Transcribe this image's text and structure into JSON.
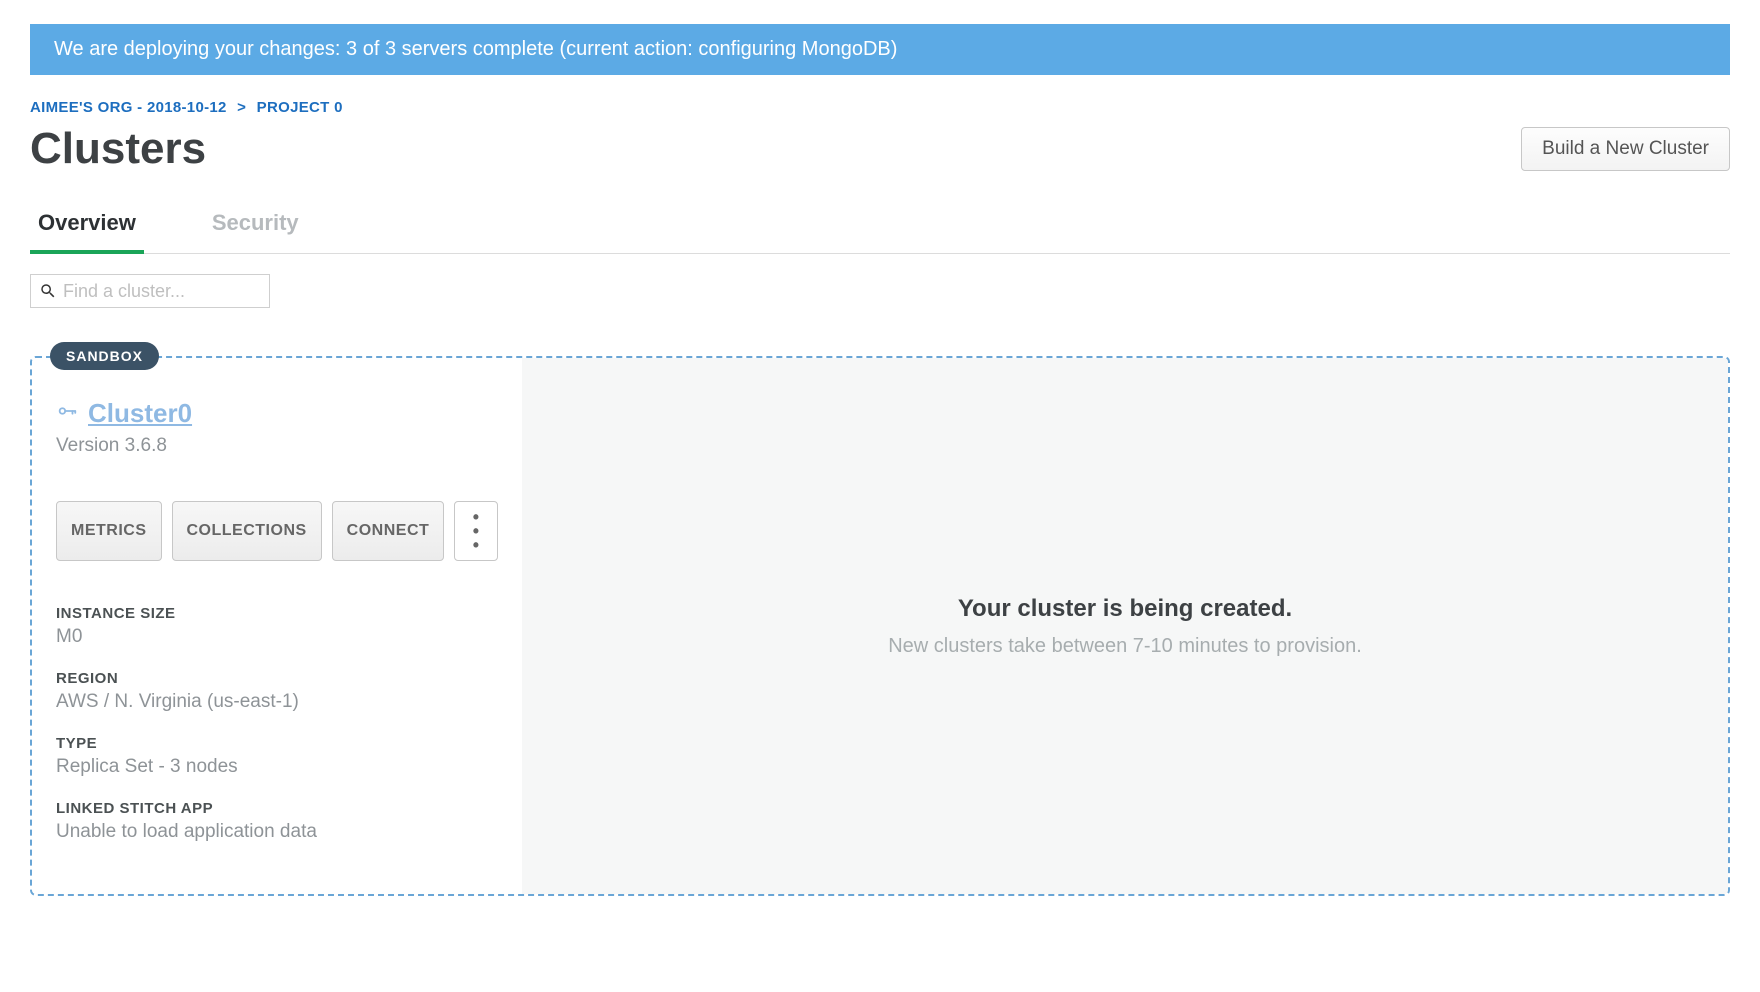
{
  "banner": {
    "text": "We are deploying your changes: 3 of 3 servers complete (current action: configuring MongoDB)"
  },
  "breadcrumb": {
    "org": "AIMEE'S ORG - 2018-10-12",
    "project": "PROJECT 0"
  },
  "header": {
    "title": "Clusters",
    "new_cluster_label": "Build a New Cluster"
  },
  "tabs": {
    "overview": "Overview",
    "security": "Security"
  },
  "search": {
    "placeholder": "Find a cluster..."
  },
  "cluster": {
    "badge": "SANDBOX",
    "name": "Cluster0",
    "version": "Version 3.6.8",
    "buttons": {
      "metrics": "METRICS",
      "collections": "COLLECTIONS",
      "connect": "CONNECT",
      "more": "• • •"
    },
    "info": {
      "instance_size_label": "INSTANCE SIZE",
      "instance_size_value": "M0",
      "region_label": "REGION",
      "region_value": "AWS / N. Virginia (us-east-1)",
      "type_label": "TYPE",
      "type_value": "Replica Set - 3 nodes",
      "stitch_label": "LINKED STITCH APP",
      "stitch_value": "Unable to load application data"
    },
    "status": {
      "title": "Your cluster is being created.",
      "subtitle": "New clusters take between 7-10 minutes to provision."
    }
  }
}
